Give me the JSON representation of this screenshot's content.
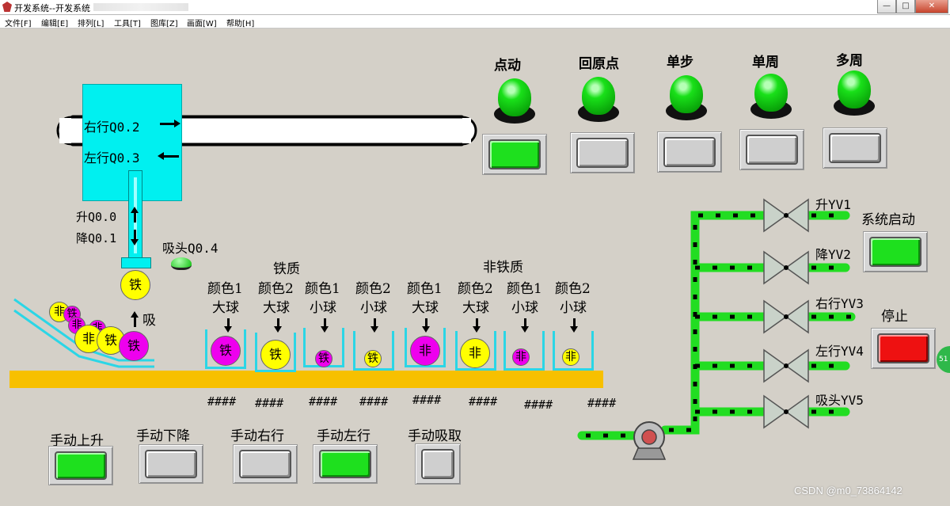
{
  "window": {
    "title": "开发系统--开发系统",
    "controls": {
      "minimize": "—",
      "maximize": "□",
      "close": "✕"
    }
  },
  "menu": [
    "文件[F]",
    "编辑[E]",
    "排列[L]",
    "工具[T]",
    "图库[Z]",
    "画面[W]",
    "帮助[H]"
  ],
  "trolley": {
    "right_label": "右行Q0.2",
    "left_label": "左行Q0.3",
    "up_label": "升Q0.0",
    "down_label": "降Q0.1",
    "suction_label": "吸头Q0.4",
    "held_ball": "铁",
    "suck_label": "吸"
  },
  "modes": [
    {
      "label": "点动",
      "active": true
    },
    {
      "label": "回原点",
      "active": false
    },
    {
      "label": "单步",
      "active": false
    },
    {
      "label": "单周",
      "active": false
    },
    {
      "label": "多周",
      "active": false
    }
  ],
  "groups": {
    "iron": "铁质",
    "nonferrous": "非铁质"
  },
  "bins": [
    {
      "line1": "颜色1",
      "line2": "大球",
      "ball": "铁",
      "color": "magenta",
      "size": "big",
      "count": "####"
    },
    {
      "line1": "颜色2",
      "line2": "大球",
      "ball": "铁",
      "color": "yellow",
      "size": "big",
      "count": "####"
    },
    {
      "line1": "颜色1",
      "line2": "小球",
      "ball": "铁",
      "color": "magenta",
      "size": "small",
      "count": "####"
    },
    {
      "line1": "颜色2",
      "line2": "小球",
      "ball": "铁",
      "color": "yellow",
      "size": "small",
      "count": "####"
    },
    {
      "line1": "颜色1",
      "line2": "大球",
      "ball": "非",
      "color": "magenta",
      "size": "big",
      "count": "####"
    },
    {
      "line1": "颜色2",
      "line2": "大球",
      "ball": "非",
      "color": "yellow",
      "size": "big",
      "count": "####"
    },
    {
      "line1": "颜色1",
      "line2": "小球",
      "ball": "非",
      "color": "magenta",
      "size": "small",
      "count": "####"
    },
    {
      "line1": "颜色2",
      "line2": "小球",
      "ball": "非",
      "color": "yellow",
      "size": "small",
      "count": "####"
    }
  ],
  "feeder_balls": [
    "非",
    "铁",
    "非",
    "非",
    "非",
    "铁",
    "铁"
  ],
  "manual": [
    {
      "label": "手动上升",
      "active": true
    },
    {
      "label": "手动下降",
      "active": false
    },
    {
      "label": "手动右行",
      "active": false
    },
    {
      "label": "手动左行",
      "active": true
    },
    {
      "label": "手动吸取",
      "active": false
    }
  ],
  "valves": [
    "升YV1",
    "降YV2",
    "右行YV3",
    "左行YV4",
    "吸头YV5"
  ],
  "system": {
    "start_label": "系统启动",
    "stop_label": "停止",
    "badge": "51"
  },
  "watermark": "CSDN @m0_73864142",
  "colors": {
    "cyan": "#00f0f0",
    "green": "#1ee01e",
    "yellow": "#ffff00",
    "magenta": "#ee00ee",
    "belt": "#f7c000",
    "stop": "#ee1111"
  }
}
